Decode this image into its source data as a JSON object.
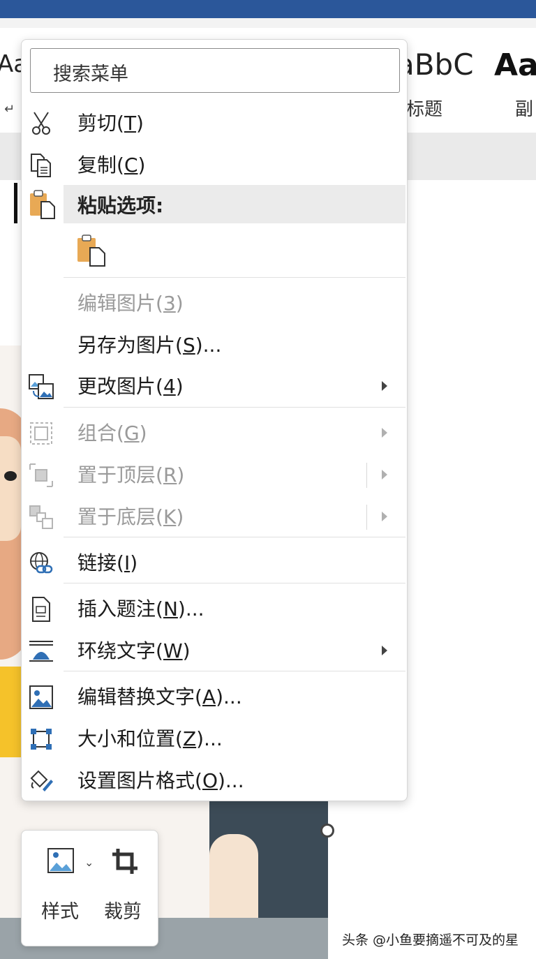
{
  "ribbon": {
    "style_previews": [
      "Aa",
      "aBbC",
      "Aa"
    ],
    "style_names": [
      "标题",
      "副"
    ],
    "paragraph_mark": "↵"
  },
  "menu": {
    "search_placeholder": "搜索菜单",
    "cut": {
      "label": "剪切(",
      "key": "T",
      "tail": ")"
    },
    "copy": {
      "label": "复制(",
      "key": "C",
      "tail": ")"
    },
    "paste_options": "粘贴选项:",
    "edit_picture": {
      "label": "编辑图片(",
      "key": "3",
      "tail": ")"
    },
    "save_as_picture": {
      "label": "另存为图片(",
      "key": "S",
      "tail": ")..."
    },
    "change_picture": {
      "label": "更改图片(",
      "key": "4",
      "tail": ")"
    },
    "group": {
      "label": "组合(",
      "key": "G",
      "tail": ")"
    },
    "bring_to_front": {
      "label": "置于顶层(",
      "key": "R",
      "tail": ")"
    },
    "send_to_back": {
      "label": "置于底层(",
      "key": "K",
      "tail": ")"
    },
    "link": {
      "label": "链接(",
      "key": "I",
      "tail": ")"
    },
    "insert_caption": {
      "label": "插入题注(",
      "key": "N",
      "tail": ")..."
    },
    "wrap_text": {
      "label": "环绕文字(",
      "key": "W",
      "tail": ")"
    },
    "edit_alt_text": {
      "label": "编辑替换文字(",
      "key": "A",
      "tail": ")..."
    },
    "size_position": {
      "label": "大小和位置(",
      "key": "Z",
      "tail": ")..."
    },
    "format_picture": {
      "label": "设置图片格式(",
      "key": "O",
      "tail": ")..."
    }
  },
  "minibar": {
    "style_label": "样式",
    "crop_label": "裁剪"
  },
  "watermark": "头条 @小鱼要摘遥不可及的星",
  "colors": {
    "title_bar": "#2b579a",
    "paste_icon": "#e8a955",
    "disabled_text": "#9a9a9a"
  }
}
